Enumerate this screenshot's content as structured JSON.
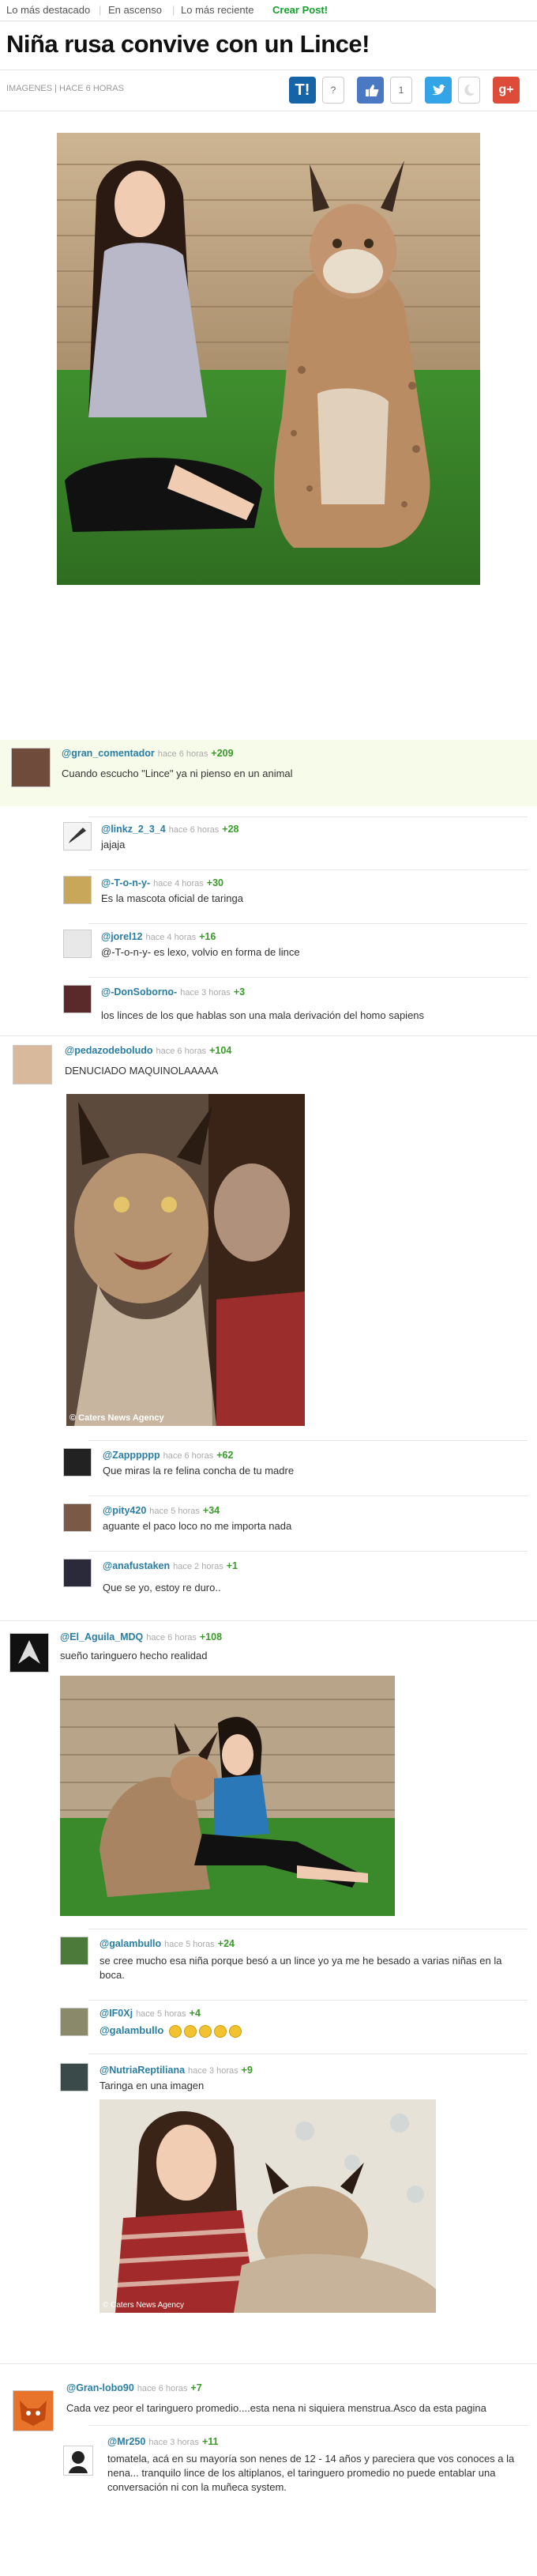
{
  "nav": {
    "items": [
      "Lo más destacado",
      "En ascenso",
      "Lo más reciente"
    ],
    "crear": "Crear Post!"
  },
  "post": {
    "title": "Niña rusa convive con un Lince!",
    "meta": "IMAGENES | HACE 6 HORAS",
    "share": {
      "question": "?",
      "likes": "1"
    }
  },
  "images": {
    "watermark1": "© Caters News Agency",
    "watermark3": "© Caters News Agency"
  },
  "comments": [
    {
      "user": "@gran_comentador",
      "time": "hace 6 horas",
      "score": "+209",
      "text": "Cuando escucho \"Lince\" ya ni pienso en un animal"
    },
    {
      "user": "@linkz_2_3_4",
      "time": "hace 6 horas",
      "score": "+28",
      "text": "jajaja"
    },
    {
      "user": "@-T-o-n-y-",
      "time": "hace 4 horas",
      "score": "+30",
      "text": "Es la mascota oficial de taringa"
    },
    {
      "user": "@jorel12",
      "time": "hace 4 horas",
      "score": "+16",
      "text": "@-T-o-n-y- es lexo, volvio en forma de lince"
    },
    {
      "user": "@-DonSoborno-",
      "time": "hace 3 horas",
      "score": "+3",
      "text": "los linces de los que hablas son una mala derivación del homo sapiens"
    },
    {
      "user": "@pedazodeboludo",
      "time": "hace 6 horas",
      "score": "+104",
      "text": "DENUCIADO MAQUINOLAAAAA"
    },
    {
      "user": "@Zapppppp",
      "time": "hace 6 horas",
      "score": "+62",
      "text": "Que miras la re felina concha de tu madre"
    },
    {
      "user": "@pity420",
      "time": "hace 5 horas",
      "score": "+34",
      "text": "aguante el paco loco no me importa nada"
    },
    {
      "user": "@anafustaken",
      "time": "hace 2 horas",
      "score": "+1",
      "text": "Que se yo, estoy re duro.."
    },
    {
      "user": "@El_Aguila_MDQ",
      "time": "hace 6 horas",
      "score": "+108",
      "text": "sueño taringuero hecho realidad"
    },
    {
      "user": "@galambullo",
      "time": "hace 5 horas",
      "score": "+24",
      "text": "se cree mucho esa niña porque besó a un lince yo ya me he besado a varias niñas en la boca."
    },
    {
      "user": "@IF0Xj",
      "time": "hace 5 horas",
      "score": "+4",
      "text": "@galambullo"
    },
    {
      "user": "@NutriaReptiliana",
      "time": "hace 3 horas",
      "score": "+9",
      "text": "Taringa en una imagen"
    },
    {
      "user": "@Gran-lobo90",
      "time": "hace 6 horas",
      "score": "+7",
      "text": "Cada vez peor el taringuero promedio....esta nena ni siquiera menstrua.Asco da esta pagina"
    },
    {
      "user": "@Mr250",
      "time": "hace 3 horas",
      "score": "+11",
      "text": "tomatela, acá en su mayoría son nenes de 12 - 14 años y pareciera que vos conoces a la nena... tranquilo lince de los altiplanos, el taringuero promedio no puede entablar una conversación ni con la muñeca system."
    }
  ]
}
